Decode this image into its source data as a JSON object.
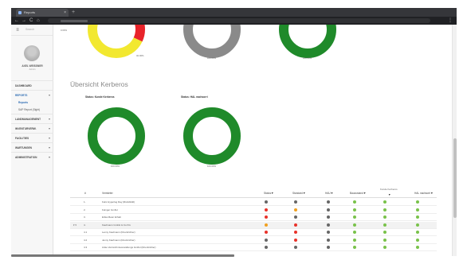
{
  "browser": {
    "tab_title": "Reports",
    "tab_close": "×",
    "new_tab": "+",
    "back": "←",
    "forward": "→",
    "reload": "C",
    "home": "⌂",
    "menu": "⋮"
  },
  "sidebar": {
    "menu_icon": "≡",
    "search_placeholder": "Search",
    "user_name": "AXEL WEISSNER",
    "user_role": "Admin",
    "items": [
      {
        "label": "DASHBOARD",
        "chev": ""
      },
      {
        "label": "REPORTS",
        "chev": "▾"
      },
      {
        "label": "LANDMANAGEMENT",
        "chev": "▾"
      },
      {
        "label": "INVENTURVERW.",
        "chev": "▾"
      },
      {
        "label": "FACILITIES",
        "chev": "▾"
      },
      {
        "label": "WARTUNGEN",
        "chev": "▾"
      },
      {
        "label": "ADMINISTRATION",
        "chev": "▾"
      }
    ],
    "subitems": [
      "Reports",
      "SAP Report (Sight)"
    ]
  },
  "top_charts": [
    {
      "pct": "32.00%",
      "left_pct": "0.00%",
      "segments": [
        {
          "color": "#e8232a",
          "value": 0.32
        },
        {
          "color": "#f2e830",
          "value": 0.68
        }
      ]
    },
    {
      "pct": "100.00%",
      "segments": [
        {
          "color": "#8a8a8a",
          "value": 1.0
        }
      ]
    },
    {
      "pct": "100.00%",
      "segments": [
        {
          "color": "#1f8a2a",
          "value": 1.0
        }
      ]
    }
  ],
  "section": {
    "title": "Übersicht Kerberos",
    "charts": [
      {
        "label": "Status: Kunde Kerberos",
        "pct": "100.00%",
        "segments": [
          {
            "color": "#1f8a2a",
            "value": 1.0
          }
        ]
      },
      {
        "label": "Status: HAL nachsorri",
        "pct": "100.00%",
        "segments": [
          {
            "color": "#1f8a2a",
            "value": 1.0
          }
        ]
      }
    ]
  },
  "table": {
    "columns": [
      "#",
      "Vermieter",
      "Status",
      "Standard",
      "HAU",
      "Bauzustand",
      "Kunde Kerberos",
      "HAL nachsorri"
    ],
    "filter_icon": "▼",
    "rows": [
      {
        "num": "1.",
        "toggle": "",
        "name": "Felix Hyperlog Day (Rückbildil)",
        "dots": [
          "#666666",
          "#666666",
          "#666666",
          "#79c24a",
          "#79c24a",
          "#79c24a"
        ],
        "highlight": false
      },
      {
        "num": "2.",
        "toggle": "",
        "name": "Felnger GmbH",
        "dots": [
          "#e8322a",
          "#f0a020",
          "#666666",
          "#79c24a",
          "#79c24a",
          "#79c24a"
        ],
        "highlight": false
      },
      {
        "num": "3.",
        "toggle": "",
        "name": "Erika Meier Erhab",
        "dots": [
          "#e8322a",
          "#666666",
          "#666666",
          "#79c24a",
          "#79c24a",
          "#79c24a"
        ],
        "highlight": false
      },
      {
        "num": "4.",
        "toggle": "▾ ▾",
        "name": "Kaufmann GmbH & Co KG",
        "dots": [
          "#f0a020",
          "#e8322a",
          "#666666",
          "#79c24a",
          "#79c24a",
          "#79c24a"
        ],
        "highlight": true
      },
      {
        "num": "4.1",
        "toggle": "",
        "name": "Lenny Kaufmann (Druckrichter)",
        "dots": [
          "#e8322a",
          "#e8322a",
          "#666666",
          "#79c24a",
          "#79c24a",
          "#79c24a"
        ],
        "highlight": false
      },
      {
        "num": "4.2",
        "toggle": "",
        "name": "Jenny Kaufmann (Druckrichter)",
        "dots": [
          "#666666",
          "#e8322a",
          "#666666",
          "#79c24a",
          "#79c24a",
          "#79c24a"
        ],
        "highlight": false
      },
      {
        "num": "4.3",
        "toggle": "",
        "name": "Anke Verzeichnisverwaltungs GmbH (Druckrichter)",
        "dots": [
          "#666666",
          "#666666",
          "#666666",
          "#79c24a",
          "#79c24a",
          "#79c24a"
        ],
        "highlight": false
      }
    ]
  }
}
